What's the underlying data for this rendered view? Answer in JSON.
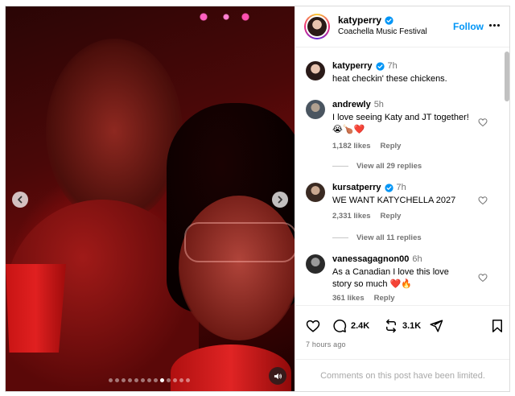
{
  "post": {
    "dots_count": 13,
    "active_dot": 8
  },
  "header": {
    "username": "katyperry",
    "location": "Coachella Music Festival",
    "follow_label": "Follow"
  },
  "caption": {
    "username": "katyperry",
    "time": "7h",
    "text": "heat checkin' these chickens."
  },
  "comments": [
    {
      "username": "andrewly",
      "time": "5h",
      "verified": false,
      "text": "I love seeing Katy and JT together! 😭🍗❤️",
      "likes": "1,182 likes",
      "reply_label": "Reply",
      "view_replies": "View all 29 replies"
    },
    {
      "username": "kursatperry",
      "time": "7h",
      "verified": true,
      "text": "WE WANT KATYCHELLA 2027",
      "likes": "2,331 likes",
      "reply_label": "Reply",
      "view_replies": "View all 11 replies"
    },
    {
      "username": "vanessagagnon00",
      "time": "6h",
      "verified": false,
      "text": "As a Canadian I love this love story so much ❤️🔥",
      "likes": "361 likes",
      "reply_label": "Reply"
    }
  ],
  "actions": {
    "comment_count": "2.4K",
    "repost_count": "3.1K",
    "time_ago": "7 hours ago"
  },
  "footer": {
    "limited_text": "Comments on this post have been limited."
  },
  "colors": {
    "accent": "#0095f6",
    "verified": "#0095f6",
    "muted": "#737373"
  }
}
